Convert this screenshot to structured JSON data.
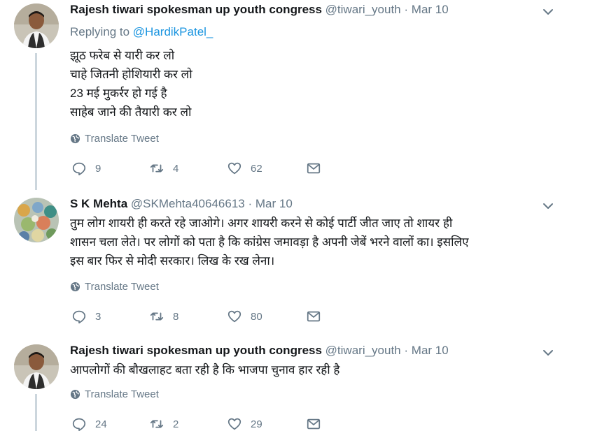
{
  "tweets": [
    {
      "name": "Rajesh tiwari spokesman up youth congress",
      "handle": "@tiwari_youth",
      "separator": "·",
      "date": "Mar 10",
      "replying_prefix": "Replying to",
      "replying_to": "@HardikPatel_",
      "lines": [
        "झूठ फरेब से यारी कर लो",
        "चाहे जितनी होशियारी कर लो",
        "23 मई मुकर्रर हो गई है",
        "साहेब जाने की तैयारी कर लो"
      ],
      "translate": "Translate Tweet",
      "replies": "9",
      "retweets": "4",
      "likes": "62"
    },
    {
      "name": "S K Mehta",
      "handle": "@SKMehta40646613",
      "separator": "·",
      "date": "Mar 10",
      "lines": [
        "तुम लोग शायरी ही करते रहे जाओगे। अगर शायरी करने से कोई पार्टी जीत जाए तो शायर ही",
        "शासन चला लेते। पर लोगों को पता है कि कांग्रेस जमावड़ा है अपनी जेबें भरने वालों का। इसलिए",
        "इस बार फिर से मोदी सरकार। लिख के रख लेना।"
      ],
      "translate": "Translate Tweet",
      "replies": "3",
      "retweets": "8",
      "likes": "80"
    },
    {
      "name": "Rajesh tiwari spokesman up youth congress",
      "handle": "@tiwari_youth",
      "separator": "·",
      "date": "Mar 10",
      "lines": [
        "आपलोगों की बौखलाहट बता रही है कि भाजपा चुनाव हार रही है"
      ],
      "translate": "Translate Tweet",
      "replies": "24",
      "retweets": "2",
      "likes": "29"
    }
  ],
  "icons": {
    "reply": "reply-icon",
    "retweet": "retweet-icon",
    "like": "heart-icon",
    "dm": "envelope-icon",
    "globe": "globe-icon",
    "caret": "chevron-down-icon"
  },
  "colors": {
    "link": "#1b95e0",
    "secondary": "#657786",
    "text": "#14171a",
    "thread": "#ccd6dd"
  }
}
